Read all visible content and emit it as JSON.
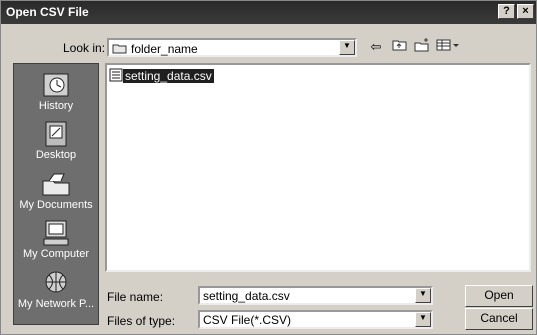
{
  "window": {
    "title": "Open CSV File",
    "help_label": "?",
    "close_label": "×"
  },
  "lookin": {
    "label": "Look in:",
    "value": "folder_name"
  },
  "places": [
    {
      "label": "History",
      "icon": "history-icon"
    },
    {
      "label": "Desktop",
      "icon": "desktop-icon"
    },
    {
      "label": "My Documents",
      "icon": "my-documents-icon"
    },
    {
      "label": "My Computer",
      "icon": "my-computer-icon"
    },
    {
      "label": "My Network P...",
      "icon": "network-places-icon"
    }
  ],
  "files": [
    {
      "name": "setting_data.csv",
      "icon": "csv-file-icon"
    }
  ],
  "filename": {
    "label": "File name:",
    "value": "setting_data.csv"
  },
  "filetype": {
    "label": "Files of type:",
    "value": "CSV File(*.CSV)"
  },
  "buttons": {
    "open": "Open",
    "cancel": "Cancel"
  }
}
